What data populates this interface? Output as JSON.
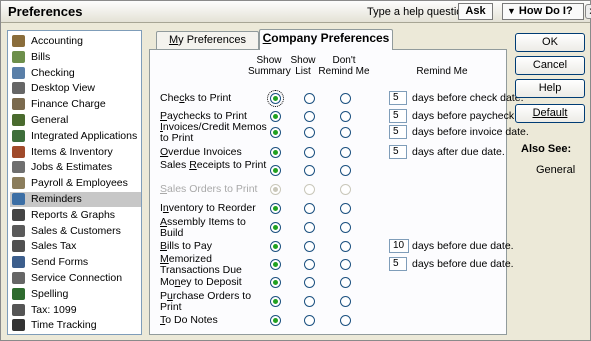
{
  "window": {
    "title": "Preferences",
    "help_label": "Type a help question",
    "ask_label": "Ask",
    "howdoi_label": "How Do I?",
    "close_label": "x"
  },
  "sidebar": {
    "items": [
      {
        "label": "Accounting",
        "icon": "accounting-icon",
        "color": "#8a6d3b"
      },
      {
        "label": "Bills",
        "icon": "bills-icon",
        "color": "#6d8f4b"
      },
      {
        "label": "Checking",
        "icon": "checking-icon",
        "color": "#5a7fa8"
      },
      {
        "label": "Desktop View",
        "icon": "desktop-view-icon",
        "color": "#666666"
      },
      {
        "label": "Finance Charge",
        "icon": "finance-charge-icon",
        "color": "#7b6a4e"
      },
      {
        "label": "General",
        "icon": "general-icon",
        "color": "#4a6b2e"
      },
      {
        "label": "Integrated Applications",
        "icon": "integrated-apps-icon",
        "color": "#3e6e3a"
      },
      {
        "label": "Items & Inventory",
        "icon": "items-inventory-icon",
        "color": "#a04a2a"
      },
      {
        "label": "Jobs & Estimates",
        "icon": "jobs-estimates-icon",
        "color": "#6f6f6f"
      },
      {
        "label": "Payroll & Employees",
        "icon": "payroll-icon",
        "color": "#8b7d5c"
      },
      {
        "label": "Reminders",
        "icon": "reminders-icon",
        "color": "#3b6ea5"
      },
      {
        "label": "Reports & Graphs",
        "icon": "reports-graphs-icon",
        "color": "#444444"
      },
      {
        "label": "Sales & Customers",
        "icon": "sales-customers-icon",
        "color": "#5a5a5a"
      },
      {
        "label": "Sales Tax",
        "icon": "sales-tax-icon",
        "color": "#505050"
      },
      {
        "label": "Send Forms",
        "icon": "send-forms-icon",
        "color": "#3c5e8c"
      },
      {
        "label": "Service Connection",
        "icon": "service-connection-icon",
        "color": "#666666"
      },
      {
        "label": "Spelling",
        "icon": "spelling-icon",
        "color": "#2e6b2e"
      },
      {
        "label": "Tax: 1099",
        "icon": "tax-1099-icon",
        "color": "#555555"
      },
      {
        "label": "Time Tracking",
        "icon": "time-tracking-icon",
        "color": "#333333"
      }
    ],
    "selected": "Reminders"
  },
  "tabs": {
    "my": "My Preferences",
    "company": "Company Preferences"
  },
  "headers": {
    "show_summary": "Show\nSummary",
    "show_list": "Show\nList",
    "dont_remind": "Don't\nRemind Me",
    "remind_me": "Remind Me"
  },
  "rows": [
    {
      "label": "Checks to Print",
      "ul": 3,
      "sel": 0,
      "days": "5",
      "suffix": "days before check date.",
      "focus": true
    },
    {
      "label": "Paychecks to Print",
      "ul": 0,
      "sel": 0,
      "days": "5",
      "suffix": "days before paycheck date."
    },
    {
      "label": "Invoices/Credit Memos to Print",
      "ul": 0,
      "sel": 0,
      "days": "5",
      "suffix": "days before invoice date."
    },
    {
      "label": "Overdue Invoices",
      "ul": 0,
      "sel": 0,
      "days": "5",
      "suffix": "days after due date."
    },
    {
      "label": "Sales Receipts to Print",
      "ul": 6,
      "sel": 0,
      "days": "",
      "suffix": ""
    },
    {
      "label": "Sales Orders to Print",
      "ul": 0,
      "sel": 0,
      "days": "",
      "suffix": "",
      "disabled": true
    },
    {
      "label": "Inventory to Reorder",
      "ul": 1,
      "sel": 0,
      "days": "",
      "suffix": ""
    },
    {
      "label": "Assembly Items to Build",
      "ul": 0,
      "sel": 0,
      "days": "",
      "suffix": ""
    },
    {
      "label": "Bills to Pay",
      "ul": 0,
      "sel": 0,
      "days": "10",
      "suffix": "days before due date."
    },
    {
      "label": "Memorized Transactions Due",
      "ul": 0,
      "sel": 0,
      "days": "5",
      "suffix": "days before due date."
    },
    {
      "label": "Money to Deposit",
      "ul": 2,
      "sel": 0,
      "days": "",
      "suffix": ""
    },
    {
      "label": "Purchase Orders to Print",
      "ul": 1,
      "sel": 0,
      "days": "",
      "suffix": ""
    },
    {
      "label": "To Do Notes",
      "ul": 0,
      "sel": 0,
      "days": "",
      "suffix": ""
    }
  ],
  "buttons": {
    "ok": "OK",
    "cancel": "Cancel",
    "help": "Help",
    "default": "Default"
  },
  "also_see": {
    "title": "Also See:",
    "items": [
      "General"
    ]
  },
  "colors": {
    "accent_radio": "#21a121",
    "selection": "#c7c7c7"
  }
}
